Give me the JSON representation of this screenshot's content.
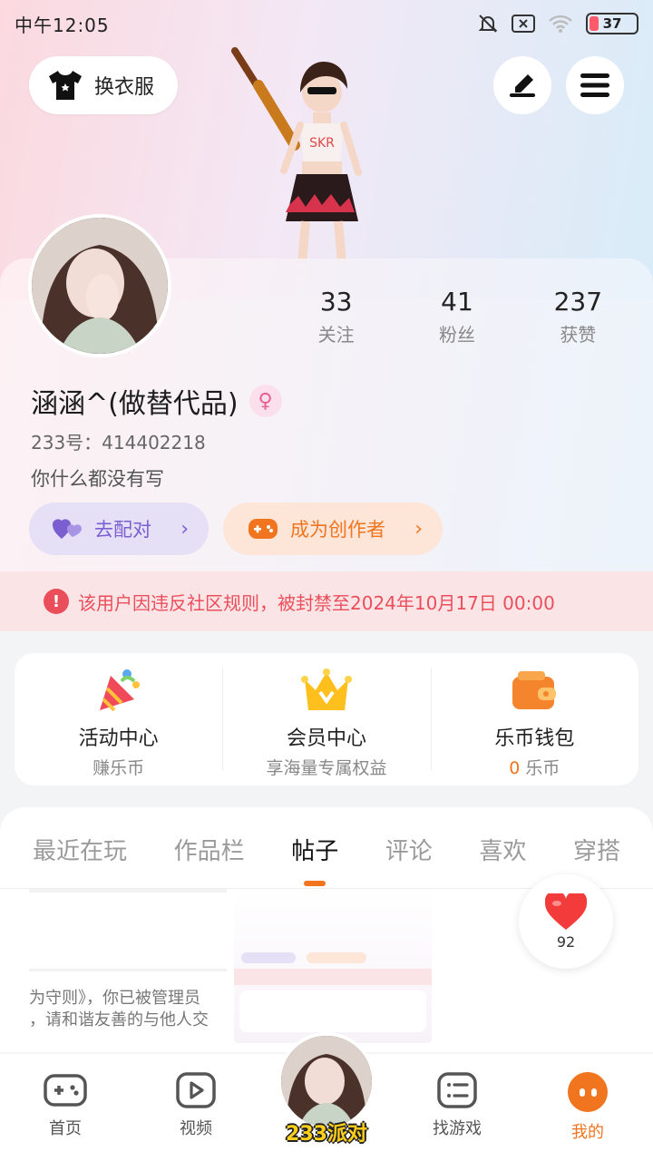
{
  "status": {
    "time": "中午12:05",
    "battery": "37"
  },
  "header": {
    "dress_label": "换衣服"
  },
  "profile": {
    "stats": [
      {
        "value": "33",
        "label": "关注"
      },
      {
        "value": "41",
        "label": "粉丝"
      },
      {
        "value": "237",
        "label": "获赞"
      }
    ],
    "nickname": "涵涵^(做替代品)",
    "uid": "233号：414402218",
    "bio": "你什么都没有写",
    "match_label": "去配对",
    "creator_label": "成为创作者"
  },
  "ban_notice": "该用户因违反社区规则，被封禁至2024年10月17日 00:00",
  "services": [
    {
      "title": "活动中心",
      "sub": "赚乐币"
    },
    {
      "title": "会员中心",
      "sub": "享海量专属权益"
    },
    {
      "title": "乐币钱包",
      "sub_value": "0",
      "sub": "乐币"
    }
  ],
  "tabs": [
    "最近在玩",
    "作品栏",
    "帖子",
    "评论",
    "喜欢",
    "穿搭"
  ],
  "feed": {
    "line1": "为守则》，你已被管理员",
    "line2": "，请和谐友善的与他人交"
  },
  "like_count": "92",
  "nav": {
    "home": "首页",
    "video": "视频",
    "party": "233派对",
    "find": "找游戏",
    "me": "我的"
  },
  "colors": {
    "accent": "#f0751e",
    "ban_red": "#ea4e5b",
    "match_purple": "#7b5ecf"
  }
}
